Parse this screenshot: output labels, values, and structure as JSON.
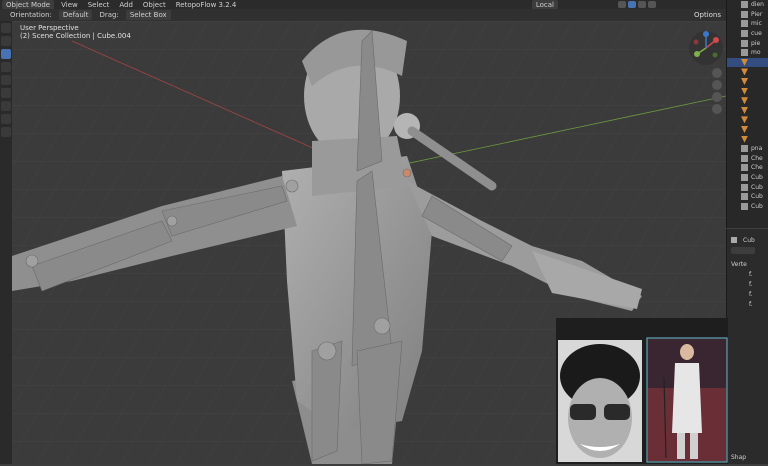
{
  "topbar": {
    "mode": "Object Mode",
    "menu_view": "View",
    "menu_select": "Select",
    "menu_add": "Add",
    "menu_object": "Object",
    "addon": "RetopoFlow 3.2.4",
    "transform_orientation": "Local"
  },
  "toolbar2": {
    "orientation_label": "Orientation:",
    "orientation_value": "Default",
    "drag_label": "Drag:",
    "drag_value": "Select Box",
    "options": "Options"
  },
  "viewport": {
    "view_name": "User Perspective",
    "collection_info": "(2) Scene Collection | Cube.004"
  },
  "outliner": {
    "items": [
      "dien",
      "Pier",
      "mic",
      "cue",
      "pie",
      "mo",
      "",
      "",
      "",
      "",
      "",
      "",
      "",
      "",
      "",
      "pna",
      "Che",
      "Che",
      "Cub",
      "Cub",
      "Cub",
      "Cub"
    ]
  },
  "properties": {
    "object_name": "Cub",
    "section": "Verte",
    "rows": [
      "f.",
      "f.",
      "f.",
      "f."
    ],
    "footer": "Shap"
  },
  "colors": {
    "accent": "#4772b3",
    "axis_x": "#d14a4a",
    "axis_y": "#7fb04a",
    "gizmo_z": "#3b78c9",
    "model_gray": "#9a9a9a",
    "selected_row": "#334d80"
  }
}
